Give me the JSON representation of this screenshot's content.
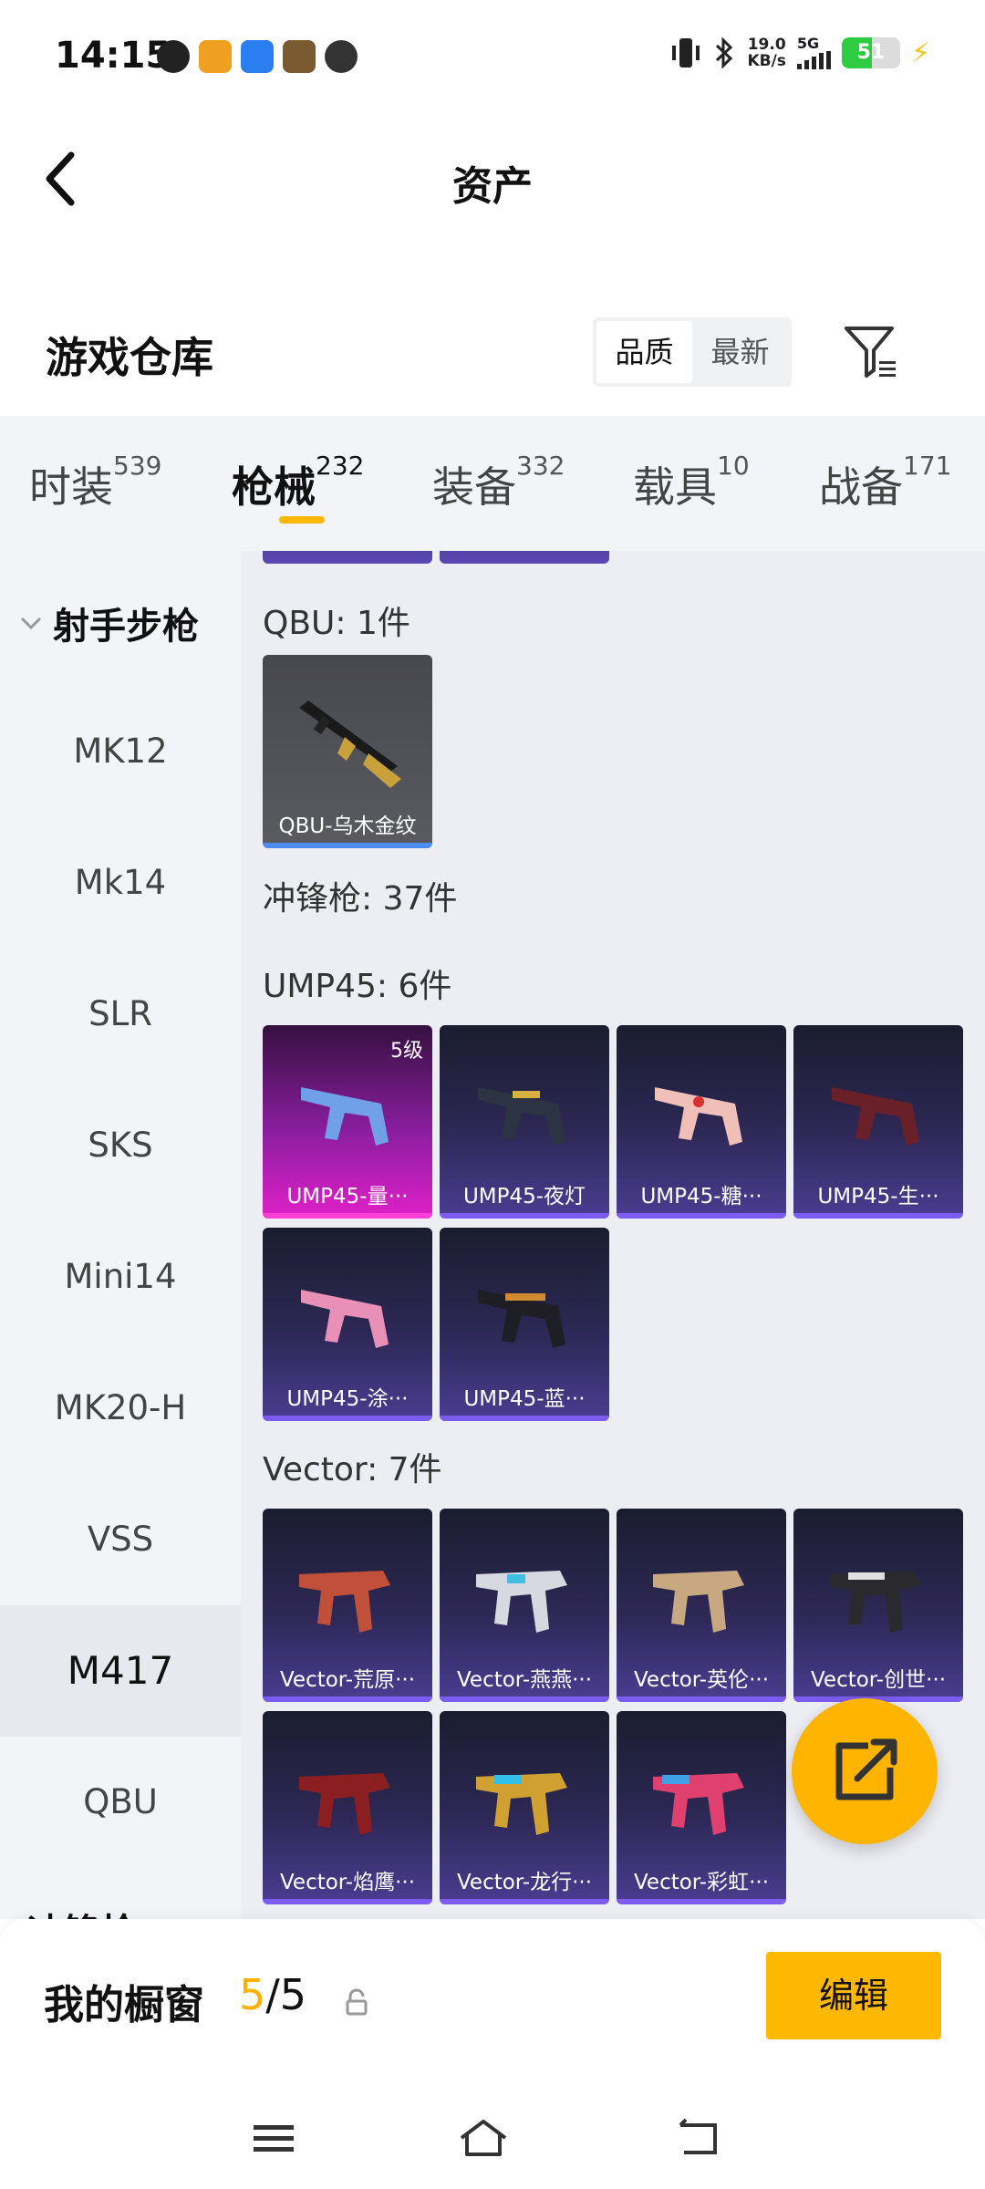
{
  "status_bar": {
    "time": "14:15",
    "net_speed_value": "19.0",
    "net_speed_unit": "KB/s",
    "network": "5G",
    "battery": "51",
    "battery_level": 0.51
  },
  "header": {
    "title": "资产"
  },
  "warehouse": {
    "title": "游戏仓库",
    "sort_options": [
      "品质",
      "最新"
    ],
    "active_sort": "品质"
  },
  "tabs": [
    {
      "label": "时装",
      "count": "539"
    },
    {
      "label": "枪械",
      "count": "232"
    },
    {
      "label": "装备",
      "count": "332"
    },
    {
      "label": "载具",
      "count": "10"
    },
    {
      "label": "战备",
      "count": "171"
    }
  ],
  "active_tab": "枪械",
  "sidebar": {
    "group": "射手步枪",
    "items": [
      "MK12",
      "Mk14",
      "SLR",
      "SKS",
      "Mini14",
      "MK20-H",
      "VSS",
      "M417",
      "QBU"
    ],
    "active": "M417",
    "next_group_peek": "冲锋枪"
  },
  "main": {
    "qbu_label": "QBU: 1件",
    "smg_label": "冲锋枪: 37件",
    "ump_label": "UMP45: 6件",
    "vector_label": "Vector: 7件",
    "qbu_cards": [
      {
        "label": "QBU-乌木金纹"
      }
    ],
    "ump_cards": [
      {
        "label": "UMP45-量···",
        "level": "5级"
      },
      {
        "label": "UMP45-夜灯"
      },
      {
        "label": "UMP45-糖···"
      },
      {
        "label": "UMP45-生···"
      },
      {
        "label": "UMP45-涂···"
      },
      {
        "label": "UMP45-蓝···"
      }
    ],
    "vector_cards": [
      {
        "label": "Vector-荒原···"
      },
      {
        "label": "Vector-燕燕···"
      },
      {
        "label": "Vector-英伦···"
      },
      {
        "label": "Vector-创世···"
      },
      {
        "label": "Vector-焰鹰···"
      },
      {
        "label": "Vector-龙行···"
      },
      {
        "label": "Vector-彩虹···"
      }
    ]
  },
  "showcase": {
    "label": "我的橱窗",
    "count_current": "5",
    "count_separator": "/",
    "count_total": "5",
    "edit_label": "编辑"
  },
  "colors": {
    "accent": "#ffb800",
    "card_purple": "#4b3d92",
    "card_pink": "#e020c8"
  }
}
